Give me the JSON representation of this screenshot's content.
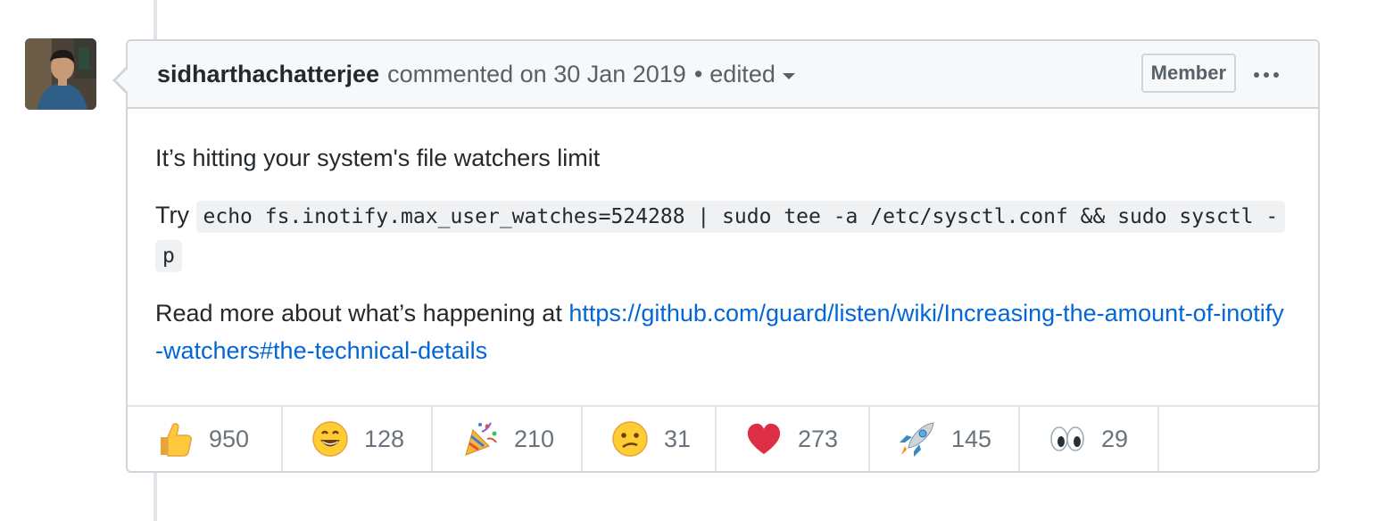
{
  "comment": {
    "author": "sidharthachatterjee",
    "action": "commented on 30 Jan 2019",
    "separator": "•",
    "edited_label": "edited",
    "badge": "Member",
    "body": {
      "line1": "It’s hitting your system's file watchers limit",
      "try_prefix": "Try",
      "code": "echo fs.inotify.max_user_watches=524288 | sudo tee -a /etc/sysctl.conf && sudo sysctl -p",
      "read_more_prefix": "Read more about what’s happening at",
      "link_text": "https://github.com/guard/listen/wiki/Increasing-the-amount-of-inotify-watchers#the-technical-details"
    }
  },
  "reactions": [
    {
      "icon": "thumbs-up-icon",
      "count": "950"
    },
    {
      "icon": "smile-icon",
      "count": "128"
    },
    {
      "icon": "party-popper-icon",
      "count": "210"
    },
    {
      "icon": "confused-icon",
      "count": "31"
    },
    {
      "icon": "heart-icon",
      "count": "273"
    },
    {
      "icon": "rocket-icon",
      "count": "145"
    },
    {
      "icon": "eyes-icon",
      "count": "29"
    }
  ],
  "colors": {
    "link": "#0366d6",
    "border": "#d1d5da",
    "header_bg": "#f6f8fa",
    "muted_text": "#586069"
  }
}
